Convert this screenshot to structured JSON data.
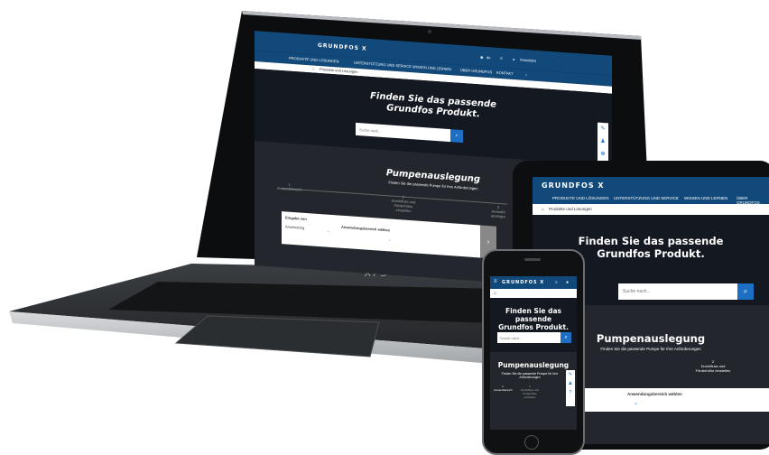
{
  "brand": {
    "logo_text": "GRUNDFOS",
    "logo_mark": "X"
  },
  "header": {
    "language": "de",
    "login_label": "Anmelden"
  },
  "nav": {
    "items": [
      "PRODUKTE UND LÖSUNGEN",
      "UNTERSTÜTZUNG UND SERVICE",
      "WISSEN UND LERNEN",
      "ÜBER GRUNDFOS",
      "KONTAKT"
    ]
  },
  "breadcrumb": {
    "label": "Produkte und Lösungen"
  },
  "hero": {
    "title_line1": "Finden Sie das passende",
    "title_line2": "Grundfos Produkt.",
    "search_placeholder": "Suche nach..."
  },
  "sizing": {
    "title": "Pumpenauslegung",
    "subtitle": "Finden Sie die passende Pumpe für Ihre Anforderungen",
    "steps": [
      {
        "num": "1",
        "label": "Anwendbereich"
      },
      {
        "num": "2",
        "label": "Durchfluss und Förderhöhe einstellen"
      },
      {
        "num": "3",
        "label": "Auswahl anzeigen"
      }
    ],
    "field1_label": "Eingabe von",
    "field1_value": "Anwendung",
    "field2_label": "Anwendungsbereich wählen"
  },
  "laptop": {
    "brand": "XPS"
  },
  "colors": {
    "header_blue": "#11497a",
    "button_blue": "#1c6fc3",
    "dark_bg": "#141820"
  }
}
